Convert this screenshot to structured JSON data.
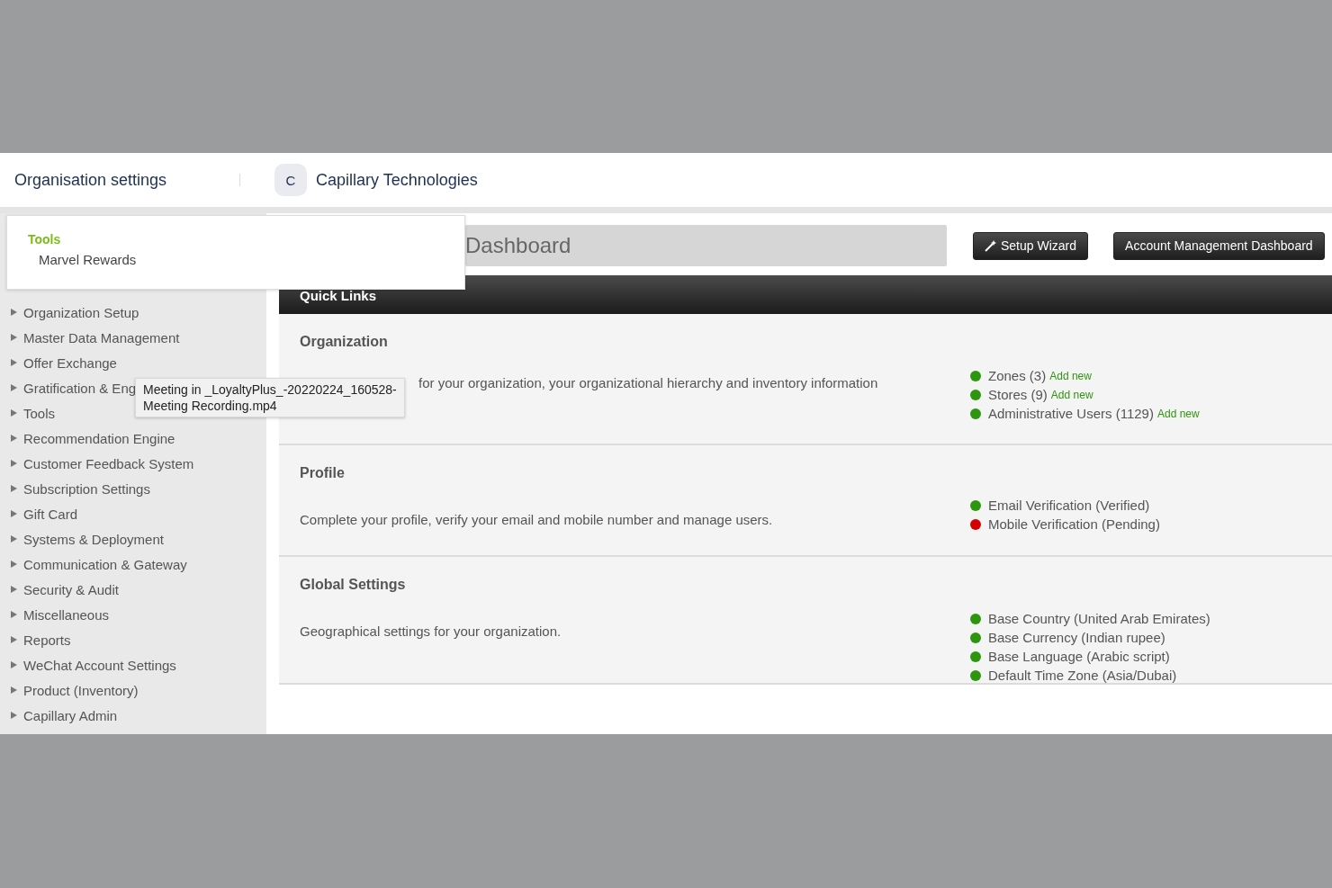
{
  "header": {
    "title": "Organisation settings",
    "org_avatar": "C",
    "org_name": "Capillary Technologies"
  },
  "dropdown": {
    "heading": "Tools",
    "items": [
      "Marvel Rewards"
    ]
  },
  "sidebar": {
    "items": [
      "Organization Setup",
      "Master Data Management",
      "Offer Exchange",
      "Gratification & Eng",
      "Tools",
      "Recommendation Engine",
      "Customer Feedback System",
      "Subscription Settings",
      "Gift Card",
      "Systems & Deployment",
      "Communication & Gateway",
      "Security & Audit",
      "Miscellaneous",
      "Reports",
      "WeChat Account Settings",
      "Product (Inventory)",
      "Capillary Admin"
    ]
  },
  "tooltip": {
    "lines": [
      "Meeting in _LoyaltyPlus_-20220224_160528-",
      "Meeting Recording.mp4"
    ]
  },
  "page": {
    "title": "Dashboard",
    "buttons": [
      {
        "label": "Setup Wizard",
        "kind": "wizard"
      },
      {
        "label": "Account Management Dashboard",
        "kind": "plain"
      }
    ]
  },
  "quick_links": {
    "title": "Quick Links",
    "sections": [
      {
        "title": "Organization",
        "description": "for your organization, your organizational hierarchy and inventory information",
        "items": [
          {
            "text": "Zones (3)",
            "link": "Add new",
            "color": "#2e960e"
          },
          {
            "text": "Stores (9)",
            "link": "Add new",
            "color": "#2e960e"
          },
          {
            "text": "Administrative Users (1129)",
            "link": "Add new",
            "color": "#2e960e"
          }
        ]
      },
      {
        "title": "Profile",
        "description": "Complete your profile, verify your email and mobile number and manage users.",
        "items": [
          {
            "text": "Email Verification (Verified)",
            "color": "#2e960e"
          },
          {
            "text": "Mobile Verification (Pending)",
            "color": "#d40000"
          }
        ]
      },
      {
        "title": "Global Settings",
        "description": "Geographical settings for your organization.",
        "items": [
          {
            "text": "Base Country (United Arab Emirates)",
            "color": "#2e960e"
          },
          {
            "text": "Base Currency (Indian rupee)",
            "color": "#2e960e"
          },
          {
            "text": "Base Language (Arabic script)",
            "color": "#2e960e"
          },
          {
            "text": "Default Time Zone (Asia/Dubai)",
            "color": "#2e960e"
          }
        ]
      }
    ]
  }
}
